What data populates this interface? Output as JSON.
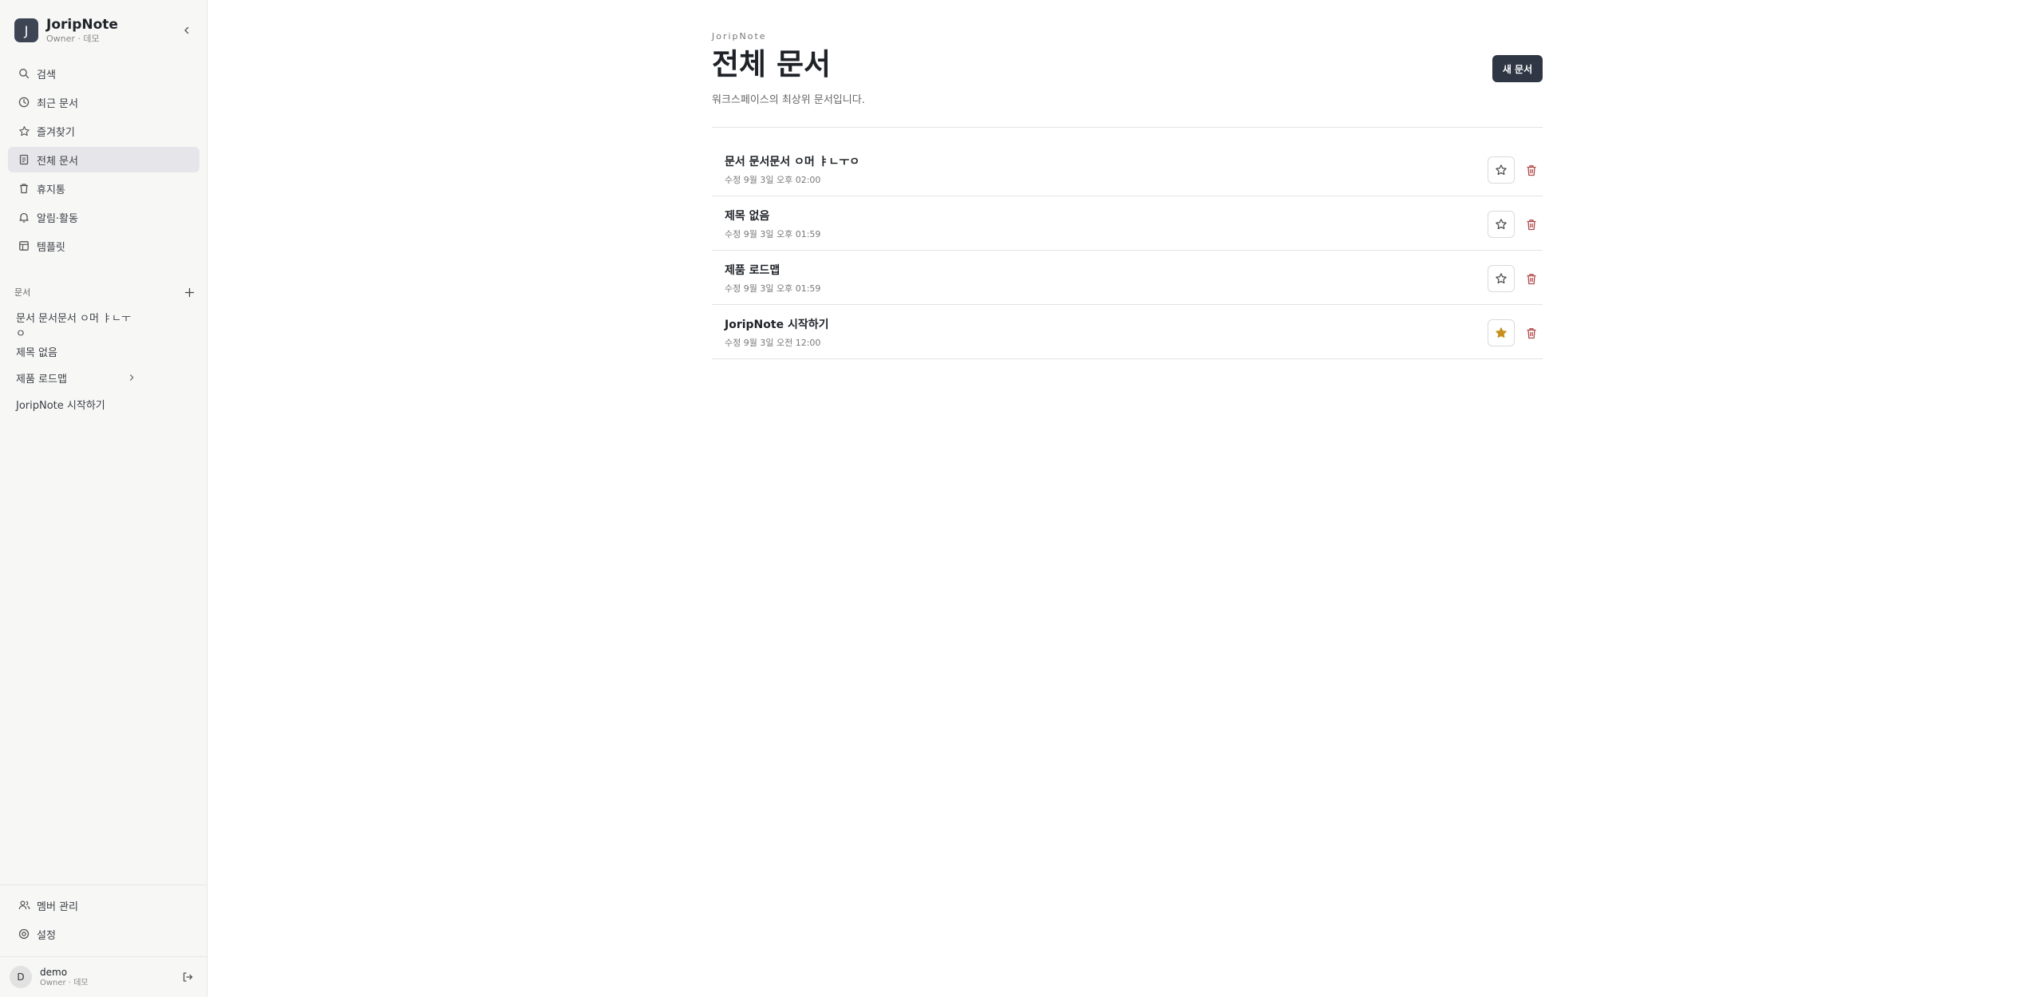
{
  "workspace": {
    "avatar_letter": "J",
    "name": "JoripNote",
    "role": "Owner · 데모"
  },
  "sidebar": {
    "nav": [
      {
        "label": "검색",
        "icon": "search-icon"
      },
      {
        "label": "최근 문서",
        "icon": "clock-icon"
      },
      {
        "label": "즐겨찾기",
        "icon": "star-icon"
      },
      {
        "label": "전체 문서",
        "icon": "document-icon",
        "active": true
      },
      {
        "label": "휴지통",
        "icon": "trash-icon"
      },
      {
        "label": "알림·활동",
        "icon": "bell-icon"
      },
      {
        "label": "템플릿",
        "icon": "template-icon"
      }
    ],
    "section_title": "문서",
    "docs": [
      {
        "label": "문서 문서문서 ㅇ머 ㅑㄴㅜㅇ"
      },
      {
        "label": "제목 없음"
      },
      {
        "label": "제품 로드맵",
        "has_children": true
      },
      {
        "label": "JoripNote 시작하기"
      }
    ],
    "footer_nav": [
      {
        "label": "멤버 관리",
        "icon": "users-icon"
      },
      {
        "label": "설정",
        "icon": "settings-icon"
      }
    ],
    "user": {
      "avatar_letter": "D",
      "name": "demo",
      "role": "Owner · 데모"
    }
  },
  "main": {
    "brand": "JoripNote",
    "title": "전체 문서",
    "description": "워크스페이스의 최상위 문서입니다.",
    "new_button": "새 문서",
    "documents": [
      {
        "title": "문서 문서문서 ㅇ머 ㅑㄴㅜㅇ",
        "meta": "수정 9월 3일 오후 02:00",
        "starred": false
      },
      {
        "title": "제목 없음",
        "meta": "수정 9월 3일 오후 01:59",
        "starred": false
      },
      {
        "title": "제품 로드맵",
        "meta": "수정 9월 3일 오후 01:59",
        "starred": false
      },
      {
        "title": "JoripNote 시작하기",
        "meta": "수정 9월 3일 오전 12:00",
        "starred": true
      }
    ]
  },
  "colors": {
    "accent": "#2f3745",
    "star_active": "#c8901c",
    "danger": "#b04a4a",
    "sidebar_bg": "#f7f7f6",
    "active_bg": "#e6e6ea"
  }
}
